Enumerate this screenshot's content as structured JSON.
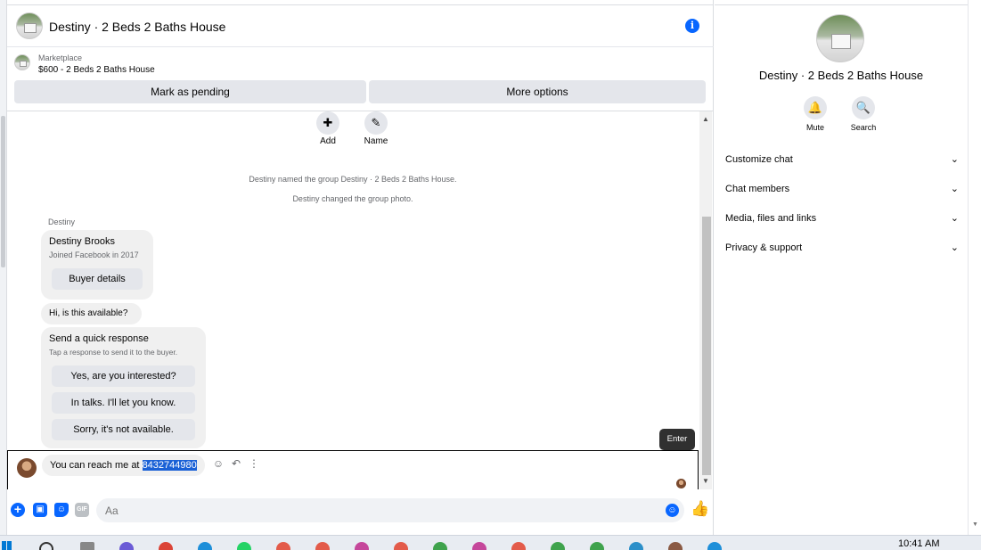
{
  "header": {
    "title": "Destiny · 2 Beds 2 Baths House",
    "info_glyph": "i"
  },
  "listing": {
    "source": "Marketplace",
    "price_title": "$600 - 2 Beds 2 Baths House"
  },
  "actions": {
    "pending_label": "Mark as pending",
    "more_label": "More options"
  },
  "group_actions": [
    {
      "label": "Add",
      "icon": "add-person-icon"
    },
    {
      "label": "Name",
      "icon": "pencil-icon"
    }
  ],
  "system_messages": [
    "Destiny named the group Destiny · 2 Beds 2 Baths House.",
    "Destiny changed the group photo."
  ],
  "conversation": {
    "sender": "Destiny",
    "profile_card": {
      "name": "Destiny Brooks",
      "subtitle": "Joined Facebook in 2017",
      "button": "Buyer details"
    },
    "message": "Hi, is this available?",
    "quick_response": {
      "title": "Send a quick response",
      "subtitle": "Tap a response to send it to the buyer.",
      "options": [
        "Yes, are you interested?",
        "In talks. I'll let you know.",
        "Sorry, it's not available."
      ]
    },
    "my_message_prefix": "You can reach me at ",
    "my_message_selected": "8432744980"
  },
  "tooltip": {
    "label": "Enter"
  },
  "composer": {
    "placeholder": "Aa"
  },
  "info_panel": {
    "title": "Destiny · 2 Beds 2 Baths House",
    "actions": [
      {
        "label": "Mute",
        "icon": "bell-icon"
      },
      {
        "label": "Search",
        "icon": "search-icon"
      }
    ],
    "sections": [
      "Customize chat",
      "Chat members",
      "Media, files and links",
      "Privacy & support"
    ]
  },
  "taskbar": {
    "clock": "10:41 AM"
  },
  "colors": {
    "accent": "#0866ff",
    "bubble": "#f0f0f0",
    "button_bg": "#e4e6eb",
    "selection": "#1a61d6"
  }
}
